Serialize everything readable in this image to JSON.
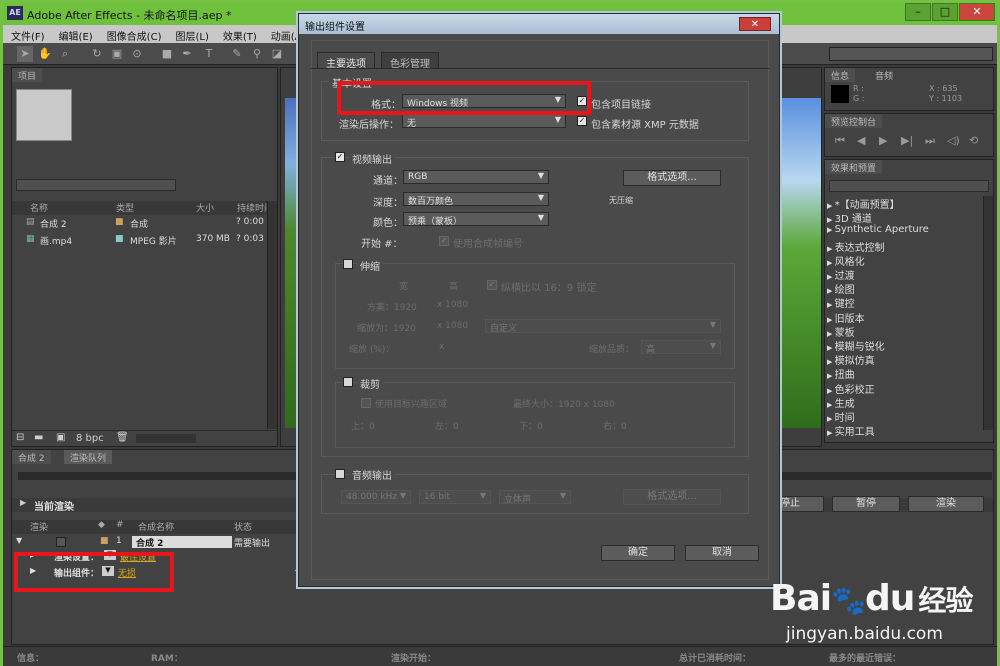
{
  "app": {
    "logo": "AE",
    "title": "Adobe After Effects - 未命名项目.aep *",
    "window_controls": [
      "–",
      "□",
      "✕"
    ]
  },
  "menu": [
    "文件(F)",
    "编辑(E)",
    "图像合成(C)",
    "图层(L)",
    "效果(T)",
    "动画(A)"
  ],
  "project_panel": {
    "tab": "项目",
    "columns": [
      "名称",
      "类型",
      "大小",
      "持续时间"
    ],
    "items": [
      {
        "name": "合成 2",
        "type": "合成",
        "size": "",
        "duration": "? 0:00"
      },
      {
        "name": "画.mp4",
        "type": "MPEG 影片",
        "size": "370 MB",
        "duration": "? 0:03"
      }
    ],
    "bpc": "8 bpc"
  },
  "info_panel": {
    "tabs": [
      "信息",
      "音频"
    ],
    "r": "R :",
    "g": "G :",
    "x": "X : 635",
    "y": "Y : 1103"
  },
  "preview_panel": {
    "tab": "预览控制台"
  },
  "effects_panel": {
    "tab": "效果和预置",
    "items": [
      "*【动画预置】",
      "3D 通道",
      "Synthetic Aperture",
      "表达式控制",
      "风格化",
      "过渡",
      "绘图",
      "键控",
      "旧版本",
      "蒙板",
      "模糊与锐化",
      "模拟仿真",
      "扭曲",
      "色彩校正",
      "生成",
      "时间",
      "实用工具"
    ]
  },
  "bottom_tabs": [
    "合成 2",
    "渲染队列"
  ],
  "render_queue": {
    "current": "当前渲染",
    "columns": [
      "渲染",
      "#",
      "合成名称",
      "状态"
    ],
    "item_num": "1",
    "item_name": "合成 2",
    "item_status": "需要输出",
    "render_settings_label": "渲染设置：",
    "render_settings_value": "最佳设置",
    "output_label": "输出组件：",
    "output_value": "无损",
    "buttons": [
      "停止",
      "暂停",
      "渲染"
    ]
  },
  "status_bar": {
    "info": "信息：",
    "ram": "RAM：",
    "render_start": "渲染开始：",
    "elapsed": "总计已消耗时间：",
    "recent_error": "最多的最近错误："
  },
  "dialog": {
    "title": "输出组件设置",
    "close": "✕",
    "tabs": [
      "主要选项",
      "色彩管理"
    ],
    "basic_settings": "基本设置",
    "format_label": "格式：",
    "format_value": "Windows 视频",
    "include_project_link": "包含项目链接",
    "post_render_label": "渲染后操作：",
    "post_render_value": "无",
    "include_xmp": "包含素材源 XMP 元数据",
    "video_output": "视频输出",
    "channel_label": "通道：",
    "channel_value": "RGB",
    "depth_label": "深度：",
    "depth_value": "数百万颜色",
    "color_label": "颜色：",
    "color_value": "预乘（蒙板）",
    "start_label": "开始 #：",
    "use_comp_frame": "使用合成帧编号",
    "format_options_btn": "格式选项...",
    "compression": "无压缩",
    "stretch": "伸缩",
    "width_label": "宽",
    "height_label": "高",
    "lock_ratio": "纵横比以 16：9 锁定",
    "render_at_label": "方案：1920",
    "render_at_h": "x  1080",
    "stretch_to_label": "缩放为：1920",
    "stretch_to_h": "x  1080",
    "stretch_custom": "自定义",
    "stretch_pct_label": "缩放 (%)：",
    "stretch_pct_x": "x",
    "stretch_quality_label": "缩放品质：",
    "stretch_quality": "高",
    "crop": "裁剪",
    "use_roi": "使用目标兴趣区域",
    "final_size": "最终大小：1920 x 1080",
    "crop_top": "上：0",
    "crop_left": "左：0",
    "crop_bottom": "下：0",
    "crop_right": "右：0",
    "audio_output": "音频输出",
    "audio_rate": "48.000 kHz",
    "audio_bits": "16 bit",
    "audio_channels": "立体声",
    "audio_format_btn": "格式选项...",
    "ok": "确定",
    "cancel": "取消"
  },
  "watermark": {
    "brand": "Bai",
    "du": "du",
    "jingyan": "经验",
    "url": "jingyan.baidu.com"
  }
}
